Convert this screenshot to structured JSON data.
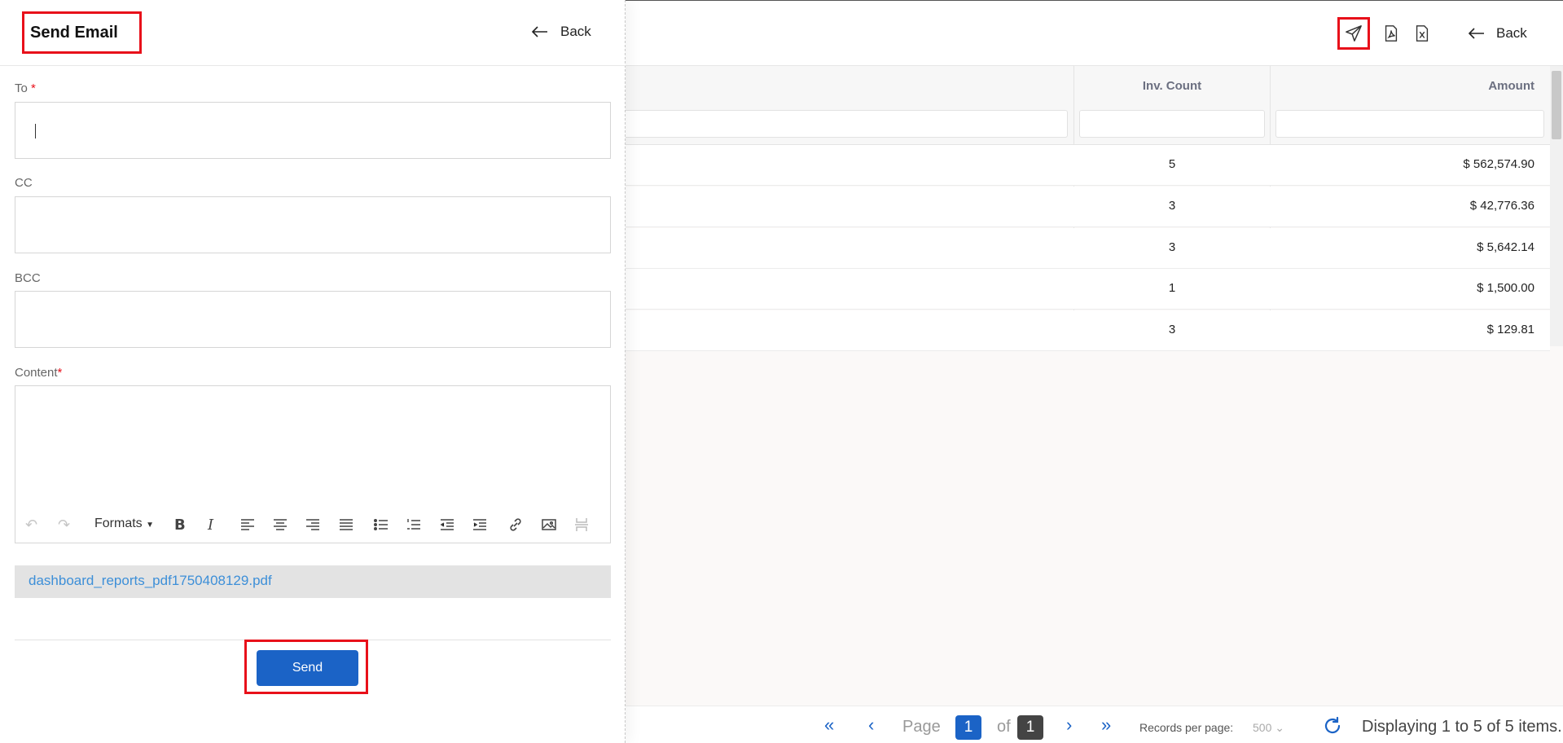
{
  "report": {
    "back_label": "Back",
    "toolbar_icons": [
      "send-icon",
      "pdf-icon",
      "excel-icon"
    ],
    "columns": {
      "inv_count": "Inv. Count",
      "amount": "Amount"
    },
    "rows": [
      {
        "inv_count": "5",
        "amount": "$ 562,574.90"
      },
      {
        "inv_count": "3",
        "amount": "$ 42,776.36"
      },
      {
        "inv_count": "3",
        "amount": "$ 5,642.14"
      },
      {
        "inv_count": "1",
        "amount": "$ 1,500.00"
      },
      {
        "inv_count": "3",
        "amount": "$ 129.81"
      }
    ],
    "pager": {
      "page_label": "Page",
      "current_page": "1",
      "of_label": "of",
      "total_pages": "1",
      "records_per_page_label": "Records per page:",
      "records_per_page_value": "500",
      "display_text": "Displaying 1 to 5 of 5 items."
    }
  },
  "panel": {
    "title": "Send Email",
    "back_label": "Back",
    "fields": {
      "to": {
        "label": "To",
        "required_mark": "*",
        "value": ""
      },
      "cc": {
        "label": "CC",
        "value": ""
      },
      "bcc": {
        "label": "BCC",
        "value": ""
      },
      "content": {
        "label": "Content",
        "required_mark": "*",
        "value": ""
      }
    },
    "editor_toolbar": {
      "formats_label": "Formats",
      "bold_label": "B",
      "italic_label": "I"
    },
    "attachment": "dashboard_reports_pdf1750408129.pdf",
    "send_label": "Send"
  },
  "colors": {
    "accent": "#1b63c6",
    "highlight": "#e8101a",
    "attachment_link": "#3d8fd8",
    "page_current_bg": "#1b63c6",
    "page_total_bg": "#444444"
  }
}
